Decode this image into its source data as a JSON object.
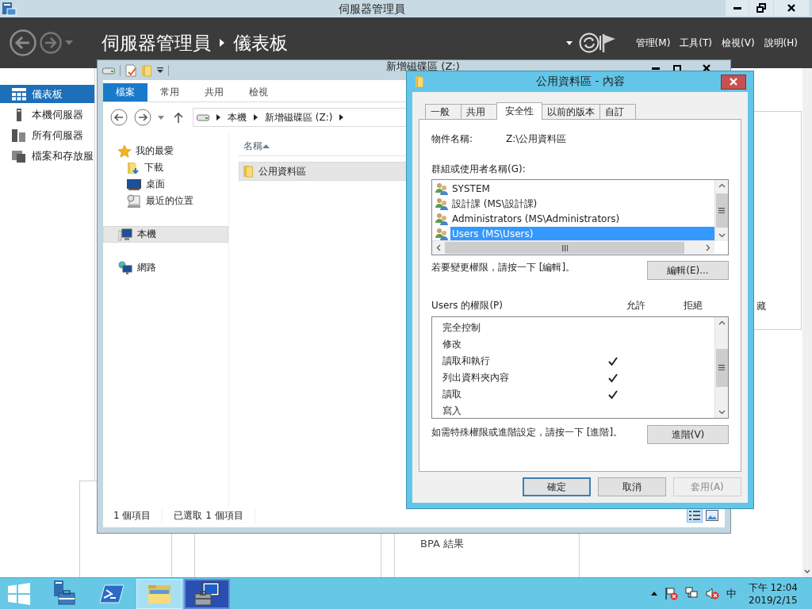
{
  "server_manager": {
    "title": "伺服器管理員",
    "breadcrumb": [
      "伺服器管理員",
      "儀表板"
    ],
    "menus": [
      "管理(M)",
      "工具(T)",
      "檢視(V)",
      "說明(H)"
    ],
    "sidebar": [
      {
        "label": "儀表板",
        "kind": "dashboard",
        "selected": true
      },
      {
        "label": "本機伺服器",
        "kind": "server",
        "selected": false
      },
      {
        "label": "所有伺服器",
        "kind": "servers",
        "selected": false
      },
      {
        "label": "檔案和存放服",
        "kind": "storage",
        "selected": false
      }
    ],
    "tile_text": "藏",
    "bpa_label": "BPA 結果"
  },
  "explorer": {
    "title": "新增磁碟區 (Z:)",
    "ribbon_tabs": [
      {
        "label": "檔案",
        "selected": true
      },
      {
        "label": "常用",
        "selected": false
      },
      {
        "label": "共用",
        "selected": false
      },
      {
        "label": "檢視",
        "selected": false
      }
    ],
    "address": [
      "本機",
      "新增磁碟區 (Z:)"
    ],
    "nav": [
      {
        "label": "我的最愛",
        "kind": "favorites",
        "selected": false,
        "children": [
          {
            "label": "下載",
            "kind": "downloads",
            "selected": false
          },
          {
            "label": "桌面",
            "kind": "desktop",
            "selected": false
          },
          {
            "label": "最近的位置",
            "kind": "recent",
            "selected": false
          }
        ]
      },
      {
        "label": "本機",
        "kind": "computer",
        "selected": true
      },
      {
        "label": "網路",
        "kind": "network",
        "selected": false
      }
    ],
    "column": "名稱",
    "files": [
      {
        "name": "公用資料區",
        "selected": true
      }
    ],
    "status": [
      "1 個項目",
      "已選取 1 個項目"
    ]
  },
  "dialog": {
    "title": "公用資料區 - 內容",
    "tabs": [
      {
        "label": "一般",
        "selected": false
      },
      {
        "label": "共用",
        "selected": false
      },
      {
        "label": "安全性",
        "selected": true
      },
      {
        "label": "以前的版本",
        "selected": false
      },
      {
        "label": "自訂",
        "selected": false
      }
    ],
    "object_label": "物件名稱:",
    "object_value": "Z:\\公用資料區",
    "groups_label": "群組或使用者名稱(G):",
    "groups": [
      {
        "name": "SYSTEM",
        "selected": false
      },
      {
        "name": "設計課 (MS\\設計課)",
        "selected": false
      },
      {
        "name": "Administrators (MS\\Administrators)",
        "selected": false
      },
      {
        "name": "Users (MS\\Users)",
        "selected": true
      }
    ],
    "edit_hint": "若要變更權限，請按一下 [編輯]。",
    "edit_button": "編輯(E)...",
    "permissions_label": "Users 的權限(P)",
    "allow_header": "允許",
    "deny_header": "拒絕",
    "permissions": [
      {
        "name": "完全控制",
        "allow": false,
        "deny": false
      },
      {
        "name": "修改",
        "allow": false,
        "deny": false
      },
      {
        "name": "讀取和執行",
        "allow": true,
        "deny": false
      },
      {
        "name": "列出資料夾內容",
        "allow": true,
        "deny": false
      },
      {
        "name": "讀取",
        "allow": true,
        "deny": false
      },
      {
        "name": "寫入",
        "allow": false,
        "deny": false
      }
    ],
    "advanced_hint": "如需特殊權限或進階設定，請按一下 [進階]。",
    "advanced_button": "進階(V)",
    "buttons": [
      {
        "label": "確定",
        "focused": true,
        "disabled": false
      },
      {
        "label": "取消",
        "focused": false,
        "disabled": false
      },
      {
        "label": "套用(A)",
        "focused": false,
        "disabled": true
      }
    ]
  },
  "taskbar": {
    "apps": [
      {
        "kind": "server_manager",
        "running": false,
        "selected": false
      },
      {
        "kind": "powershell",
        "running": false,
        "selected": false
      },
      {
        "kind": "explorer",
        "running": true,
        "selected": false
      },
      {
        "kind": "properties",
        "running": true,
        "selected": true
      }
    ],
    "ime": "中",
    "time": "下午 12:04",
    "date": "2019/2/15"
  }
}
